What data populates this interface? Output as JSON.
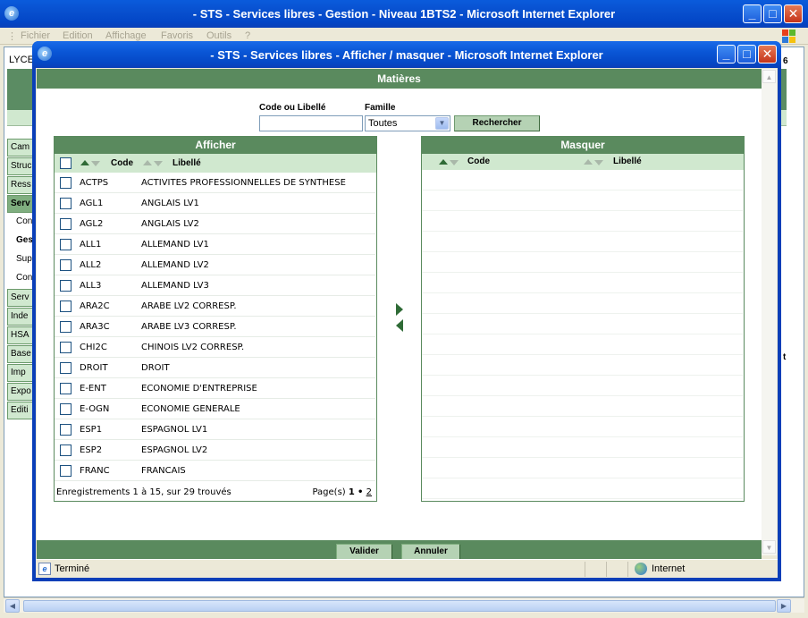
{
  "outer_window": {
    "title": "- STS - Services libres - Gestion - Niveau 1BTS2 - Microsoft Internet Explorer",
    "menu": [
      "Fichier",
      "Edition",
      "Affichage",
      "Favoris",
      "Outils",
      "?"
    ],
    "lyce_label": "LYCE",
    "right_clip_1": "6",
    "right_clip_2": "t",
    "sidebar": [
      {
        "label": "Cam",
        "style": "item"
      },
      {
        "label": "Struc",
        "style": "item"
      },
      {
        "label": "Ress",
        "style": "item"
      },
      {
        "label": "Serv",
        "style": "active"
      },
      {
        "label": "Con",
        "style": "sub"
      },
      {
        "label": "Ges",
        "style": "bold"
      },
      {
        "label": "Sup",
        "style": "sub"
      },
      {
        "label": "Con",
        "style": "sub"
      },
      {
        "label": "Serv",
        "style": "item"
      },
      {
        "label": "Inde",
        "style": "item"
      },
      {
        "label": "HSA",
        "style": "item"
      },
      {
        "label": "Base",
        "style": "item"
      },
      {
        "label": "Imp",
        "style": "item"
      },
      {
        "label": "Expo",
        "style": "item"
      },
      {
        "label": "Editi",
        "style": "item"
      }
    ]
  },
  "popup": {
    "title": "- STS - Services libres - Afficher / masquer - Microsoft Internet Explorer",
    "header": "Matières",
    "filter": {
      "code_label": "Code ou Libellé",
      "code_value": "",
      "famille_label": "Famille",
      "famille_value": "Toutes",
      "search_button": "Rechercher"
    },
    "afficher": {
      "title": "Afficher",
      "col_code": "Code",
      "col_libelle": "Libellé",
      "rows": [
        {
          "code": "ACTPS",
          "libelle": "ACTIVITES PROFESSIONNELLES DE SYNTHESE"
        },
        {
          "code": "AGL1",
          "libelle": "ANGLAIS LV1"
        },
        {
          "code": "AGL2",
          "libelle": "ANGLAIS LV2"
        },
        {
          "code": "ALL1",
          "libelle": "ALLEMAND LV1"
        },
        {
          "code": "ALL2",
          "libelle": "ALLEMAND LV2"
        },
        {
          "code": "ALL3",
          "libelle": "ALLEMAND LV3"
        },
        {
          "code": "ARA2C",
          "libelle": "ARABE LV2 CORRESP."
        },
        {
          "code": "ARA3C",
          "libelle": "ARABE LV3 CORRESP."
        },
        {
          "code": "CHI2C",
          "libelle": "CHINOIS LV2 CORRESP."
        },
        {
          "code": "DROIT",
          "libelle": "DROIT"
        },
        {
          "code": "E-ENT",
          "libelle": "ECONOMIE D'ENTREPRISE"
        },
        {
          "code": "E-OGN",
          "libelle": "ECONOMIE GENERALE"
        },
        {
          "code": "ESP1",
          "libelle": "ESPAGNOL LV1"
        },
        {
          "code": "ESP2",
          "libelle": "ESPAGNOL LV2"
        },
        {
          "code": "FRANC",
          "libelle": "FRANCAIS"
        }
      ],
      "footer_records": "Enregistrements 1 à 15, sur 29 trouvés",
      "footer_pages_label": "Page(s)",
      "footer_page_current": "1",
      "footer_sep": "•",
      "footer_page_next": "2"
    },
    "masquer": {
      "title": "Masquer",
      "col_code": "Code",
      "col_libelle": "Libellé",
      "empty_rows": 16
    },
    "buttons": {
      "valider": "Valider",
      "annuler": "Annuler"
    },
    "status": {
      "text": "Terminé",
      "zone": "Internet"
    }
  }
}
